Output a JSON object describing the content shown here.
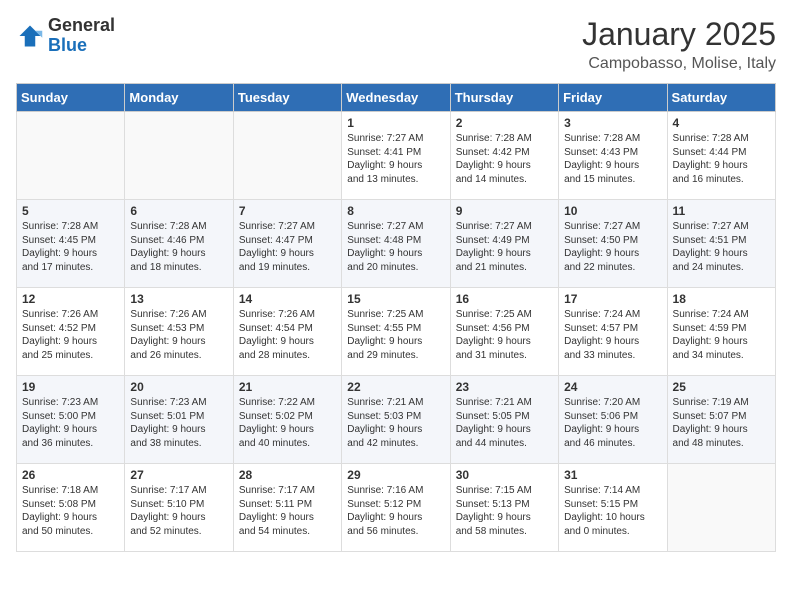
{
  "logo": {
    "general": "General",
    "blue": "Blue"
  },
  "header": {
    "title": "January 2025",
    "subtitle": "Campobasso, Molise, Italy"
  },
  "weekdays": [
    "Sunday",
    "Monday",
    "Tuesday",
    "Wednesday",
    "Thursday",
    "Friday",
    "Saturday"
  ],
  "weeks": [
    [
      {
        "day": "",
        "info": ""
      },
      {
        "day": "",
        "info": ""
      },
      {
        "day": "",
        "info": ""
      },
      {
        "day": "1",
        "info": "Sunrise: 7:27 AM\nSunset: 4:41 PM\nDaylight: 9 hours\nand 13 minutes."
      },
      {
        "day": "2",
        "info": "Sunrise: 7:28 AM\nSunset: 4:42 PM\nDaylight: 9 hours\nand 14 minutes."
      },
      {
        "day": "3",
        "info": "Sunrise: 7:28 AM\nSunset: 4:43 PM\nDaylight: 9 hours\nand 15 minutes."
      },
      {
        "day": "4",
        "info": "Sunrise: 7:28 AM\nSunset: 4:44 PM\nDaylight: 9 hours\nand 16 minutes."
      }
    ],
    [
      {
        "day": "5",
        "info": "Sunrise: 7:28 AM\nSunset: 4:45 PM\nDaylight: 9 hours\nand 17 minutes."
      },
      {
        "day": "6",
        "info": "Sunrise: 7:28 AM\nSunset: 4:46 PM\nDaylight: 9 hours\nand 18 minutes."
      },
      {
        "day": "7",
        "info": "Sunrise: 7:27 AM\nSunset: 4:47 PM\nDaylight: 9 hours\nand 19 minutes."
      },
      {
        "day": "8",
        "info": "Sunrise: 7:27 AM\nSunset: 4:48 PM\nDaylight: 9 hours\nand 20 minutes."
      },
      {
        "day": "9",
        "info": "Sunrise: 7:27 AM\nSunset: 4:49 PM\nDaylight: 9 hours\nand 21 minutes."
      },
      {
        "day": "10",
        "info": "Sunrise: 7:27 AM\nSunset: 4:50 PM\nDaylight: 9 hours\nand 22 minutes."
      },
      {
        "day": "11",
        "info": "Sunrise: 7:27 AM\nSunset: 4:51 PM\nDaylight: 9 hours\nand 24 minutes."
      }
    ],
    [
      {
        "day": "12",
        "info": "Sunrise: 7:26 AM\nSunset: 4:52 PM\nDaylight: 9 hours\nand 25 minutes."
      },
      {
        "day": "13",
        "info": "Sunrise: 7:26 AM\nSunset: 4:53 PM\nDaylight: 9 hours\nand 26 minutes."
      },
      {
        "day": "14",
        "info": "Sunrise: 7:26 AM\nSunset: 4:54 PM\nDaylight: 9 hours\nand 28 minutes."
      },
      {
        "day": "15",
        "info": "Sunrise: 7:25 AM\nSunset: 4:55 PM\nDaylight: 9 hours\nand 29 minutes."
      },
      {
        "day": "16",
        "info": "Sunrise: 7:25 AM\nSunset: 4:56 PM\nDaylight: 9 hours\nand 31 minutes."
      },
      {
        "day": "17",
        "info": "Sunrise: 7:24 AM\nSunset: 4:57 PM\nDaylight: 9 hours\nand 33 minutes."
      },
      {
        "day": "18",
        "info": "Sunrise: 7:24 AM\nSunset: 4:59 PM\nDaylight: 9 hours\nand 34 minutes."
      }
    ],
    [
      {
        "day": "19",
        "info": "Sunrise: 7:23 AM\nSunset: 5:00 PM\nDaylight: 9 hours\nand 36 minutes."
      },
      {
        "day": "20",
        "info": "Sunrise: 7:23 AM\nSunset: 5:01 PM\nDaylight: 9 hours\nand 38 minutes."
      },
      {
        "day": "21",
        "info": "Sunrise: 7:22 AM\nSunset: 5:02 PM\nDaylight: 9 hours\nand 40 minutes."
      },
      {
        "day": "22",
        "info": "Sunrise: 7:21 AM\nSunset: 5:03 PM\nDaylight: 9 hours\nand 42 minutes."
      },
      {
        "day": "23",
        "info": "Sunrise: 7:21 AM\nSunset: 5:05 PM\nDaylight: 9 hours\nand 44 minutes."
      },
      {
        "day": "24",
        "info": "Sunrise: 7:20 AM\nSunset: 5:06 PM\nDaylight: 9 hours\nand 46 minutes."
      },
      {
        "day": "25",
        "info": "Sunrise: 7:19 AM\nSunset: 5:07 PM\nDaylight: 9 hours\nand 48 minutes."
      }
    ],
    [
      {
        "day": "26",
        "info": "Sunrise: 7:18 AM\nSunset: 5:08 PM\nDaylight: 9 hours\nand 50 minutes."
      },
      {
        "day": "27",
        "info": "Sunrise: 7:17 AM\nSunset: 5:10 PM\nDaylight: 9 hours\nand 52 minutes."
      },
      {
        "day": "28",
        "info": "Sunrise: 7:17 AM\nSunset: 5:11 PM\nDaylight: 9 hours\nand 54 minutes."
      },
      {
        "day": "29",
        "info": "Sunrise: 7:16 AM\nSunset: 5:12 PM\nDaylight: 9 hours\nand 56 minutes."
      },
      {
        "day": "30",
        "info": "Sunrise: 7:15 AM\nSunset: 5:13 PM\nDaylight: 9 hours\nand 58 minutes."
      },
      {
        "day": "31",
        "info": "Sunrise: 7:14 AM\nSunset: 5:15 PM\nDaylight: 10 hours\nand 0 minutes."
      },
      {
        "day": "",
        "info": ""
      }
    ]
  ]
}
